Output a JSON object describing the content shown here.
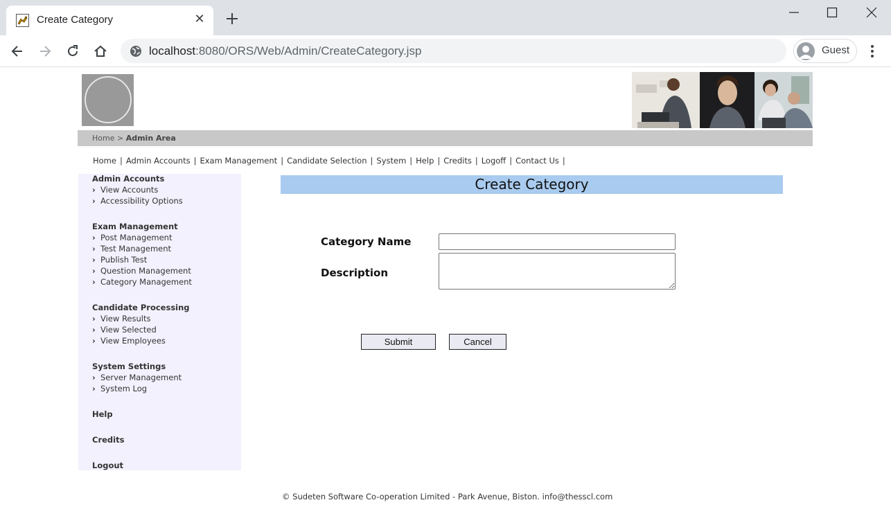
{
  "browser": {
    "tab_title": "Create Category",
    "url_host": "localhost",
    "url_rest": ":8080/ORS/Web/Admin/CreateCategory.jsp",
    "profile_label": "Guest"
  },
  "breadcrumb": {
    "home": "Home",
    "separator": ">",
    "current": "Admin Area"
  },
  "topnav": [
    {
      "label": "Home"
    },
    {
      "label": "Admin Accounts"
    },
    {
      "label": "Exam Management"
    },
    {
      "label": "Candidate Selection"
    },
    {
      "label": "System"
    },
    {
      "label": "Help"
    },
    {
      "label": "Credits"
    },
    {
      "label": "Logoff"
    },
    {
      "label": "Contact Us"
    }
  ],
  "topnav_separator": "|",
  "sidebar": {
    "admin_accounts": {
      "title": "Admin Accounts",
      "items": [
        "View Accounts",
        "Accessibility Options"
      ]
    },
    "exam_management": {
      "title": "Exam Management",
      "items": [
        "Post Management",
        "Test Management",
        "Publish Test",
        "Question Management",
        "Category Management"
      ]
    },
    "candidate_processing": {
      "title": "Candidate Processing",
      "items": [
        "View Results",
        "View Selected",
        "View Employees"
      ]
    },
    "system_settings": {
      "title": "System Settings",
      "items": [
        "Server Management",
        "System Log"
      ]
    },
    "help": "Help",
    "credits": "Credits",
    "logout": "Logout"
  },
  "form": {
    "title": "Create Category",
    "category_name_label": "Category Name",
    "category_name_value": "",
    "description_label": "Description",
    "description_value": "",
    "submit_label": "Submit",
    "cancel_label": "Cancel"
  },
  "footer": {
    "text": "© Sudeten Software Co-operation Limited - Park Avenue, Biston. info@thesscl.com"
  },
  "colors": {
    "title_bar": "#a9cbef",
    "sidebar_bg": "#f3f1fd",
    "breadcrumb_bar": "#c8c8c8"
  }
}
